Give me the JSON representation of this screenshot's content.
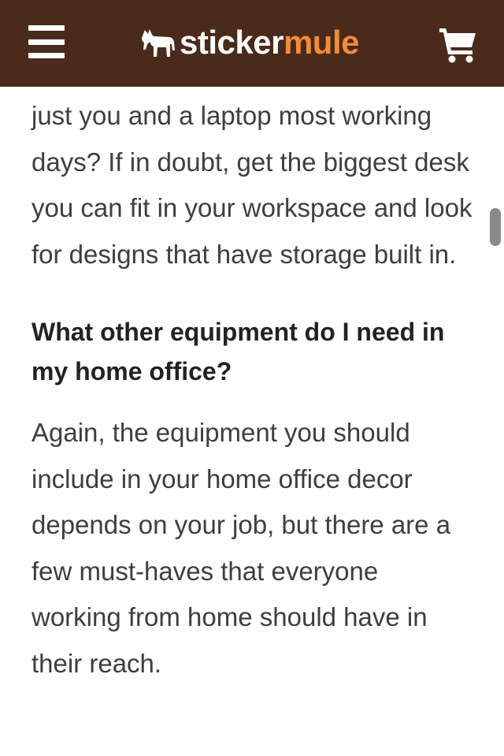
{
  "header": {
    "logo_primary": "sticker",
    "logo_secondary": "mule",
    "menu_icon": "hamburger-menu-icon",
    "cart_icon": "shopping-cart-icon",
    "background_color": "#4a2a1a",
    "accent_color": "#f28b3c"
  },
  "article": {
    "paragraph_1": "just you and a laptop most working days? If in doubt, get the biggest desk you can fit in your workspace and look for designs that have storage built in.",
    "heading": "What other equipment do I need in my home office?",
    "paragraph_2": "Again, the equipment you should include in your home office decor depends on your job, but there are a few must-haves that everyone working from home should have in their reach."
  }
}
